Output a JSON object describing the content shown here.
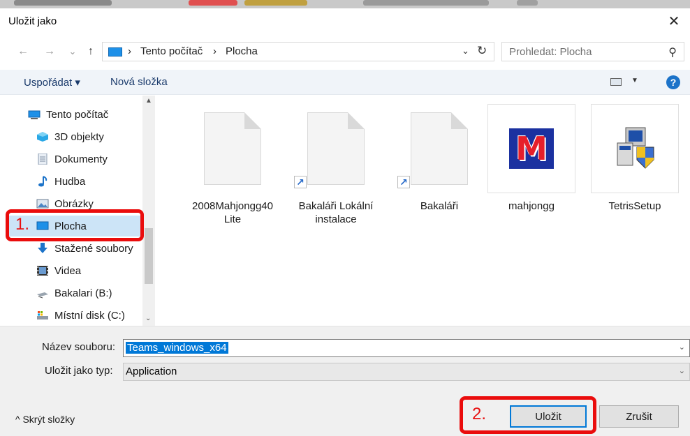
{
  "window": {
    "title": "Uložit jako",
    "close_glyph": "✕"
  },
  "nav": {
    "back_glyph": "←",
    "forward_glyph": "→",
    "recent_glyph": "⌄",
    "up_glyph": "↑",
    "breadcrumb_sep": "›",
    "breadcrumb": [
      "Tento počítač",
      "Plocha"
    ],
    "dropdown_glyph": "⌄",
    "refresh_glyph": "↻",
    "search_placeholder": "Prohledat: Plocha",
    "search_glyph": "⚲"
  },
  "toolbar": {
    "organize": "Uspořádat ▾",
    "new_folder": "Nová složka",
    "view_dd": "▼",
    "help": "?"
  },
  "sidebar": {
    "items": [
      {
        "label": "Tento počítač",
        "icon": "computer-icon"
      },
      {
        "label": "3D objekty",
        "icon": "cube-icon"
      },
      {
        "label": "Dokumenty",
        "icon": "document-icon"
      },
      {
        "label": "Hudba",
        "icon": "music-icon"
      },
      {
        "label": "Obrázky",
        "icon": "picture-icon"
      },
      {
        "label": "Plocha",
        "icon": "desktop-icon",
        "selected": true
      },
      {
        "label": "Stažené soubory",
        "icon": "download-icon"
      },
      {
        "label": "Videa",
        "icon": "video-icon"
      },
      {
        "label": "Bakalari (B:)",
        "icon": "network-drive-icon"
      },
      {
        "label": "Místní disk (C:)",
        "icon": "disk-icon"
      }
    ],
    "scroll_up": "▲",
    "scroll_down": "⌄"
  },
  "files": [
    {
      "name": "2008Mahjongg40 Lite",
      "type": "blank-document",
      "shortcut": false
    },
    {
      "name": "Bakaláři Lokální instalace",
      "type": "blank-document",
      "shortcut": true
    },
    {
      "name": "Bakaláři",
      "type": "blank-document",
      "shortcut": true
    },
    {
      "name": "mahjongg",
      "type": "mahjongg-app",
      "letter": "M"
    },
    {
      "name": "TetrisSetup",
      "type": "installer-app"
    }
  ],
  "shortcut_glyph": "↗",
  "form": {
    "filename_label": "Název souboru:",
    "filename_value": "Teams_windows_x64",
    "type_label": "Uložit jako typ:",
    "type_value": "Application",
    "chevron": "⌄"
  },
  "footer": {
    "hide_folders": "^ Skrýt složky",
    "save": "Uložit",
    "cancel": "Zrušit"
  },
  "annotations": {
    "step1": "1.",
    "step2": "2.",
    "color": "#ea0c0c"
  }
}
